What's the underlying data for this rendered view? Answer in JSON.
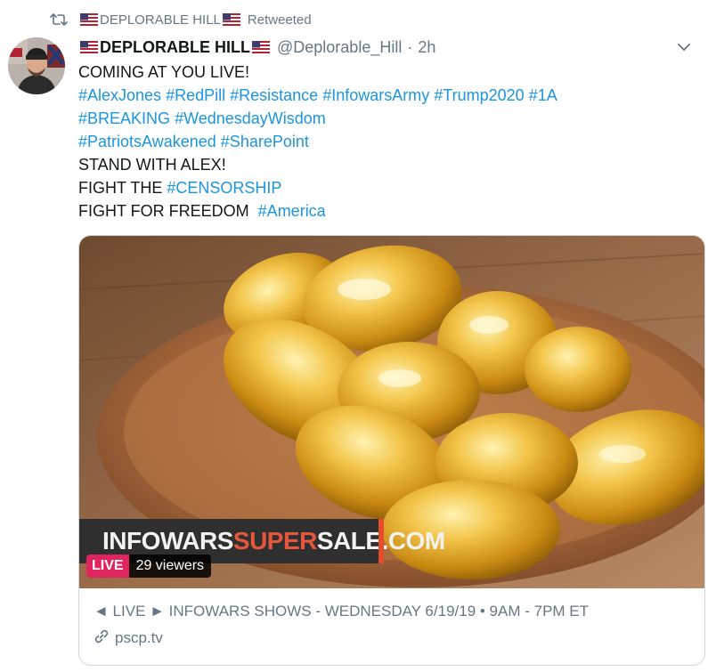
{
  "retweet": {
    "user_name": "DEPLORABLE HILL",
    "label": "Retweeted"
  },
  "tweet": {
    "display_name": "DEPLORABLE HILL",
    "handle": "@Deplorable_Hill",
    "separator": "·",
    "time": "2h",
    "lines": [
      {
        "text": "COMING AT YOU LIVE!"
      },
      {
        "tags": [
          "#AlexJones",
          "#RedPill",
          "#Resistance",
          "#InfowarsArmy",
          "#Trump2020",
          "#1A"
        ]
      },
      {
        "tags": [
          "#BREAKING",
          "#WednesdayWisdom"
        ]
      },
      {
        "tags": [
          "#PatriotsAwakened",
          "#SharePoint"
        ]
      },
      {
        "text": "STAND WITH ALEX!"
      },
      {
        "prefix": "FIGHT THE ",
        "tag": "#CENSORSHIP"
      },
      {
        "prefix": "FIGHT FOR FREEDOM  ",
        "tag": "#America"
      }
    ]
  },
  "card": {
    "banner_part1": "INFOWARS",
    "banner_part2": "SUPER",
    "banner_part3": "SALE.COM",
    "live_label": "LIVE",
    "viewers": "29 viewers",
    "title": "◄ LIVE ► INFOWARS SHOWS - WEDNESDAY 6/19/19 • 9AM - 7PM ET",
    "domain": "pscp.tv"
  },
  "icons": {
    "retweet": "retweet-icon",
    "flag": "us-flag-icon",
    "chevron": "chevron-down-icon",
    "link": "link-icon"
  },
  "colors": {
    "hashtag": "#1b95e0",
    "secondary_text": "#657786",
    "live_badge": "#e0245e",
    "banner_accent": "#e4573b",
    "card_border": "#ccd6dd"
  }
}
